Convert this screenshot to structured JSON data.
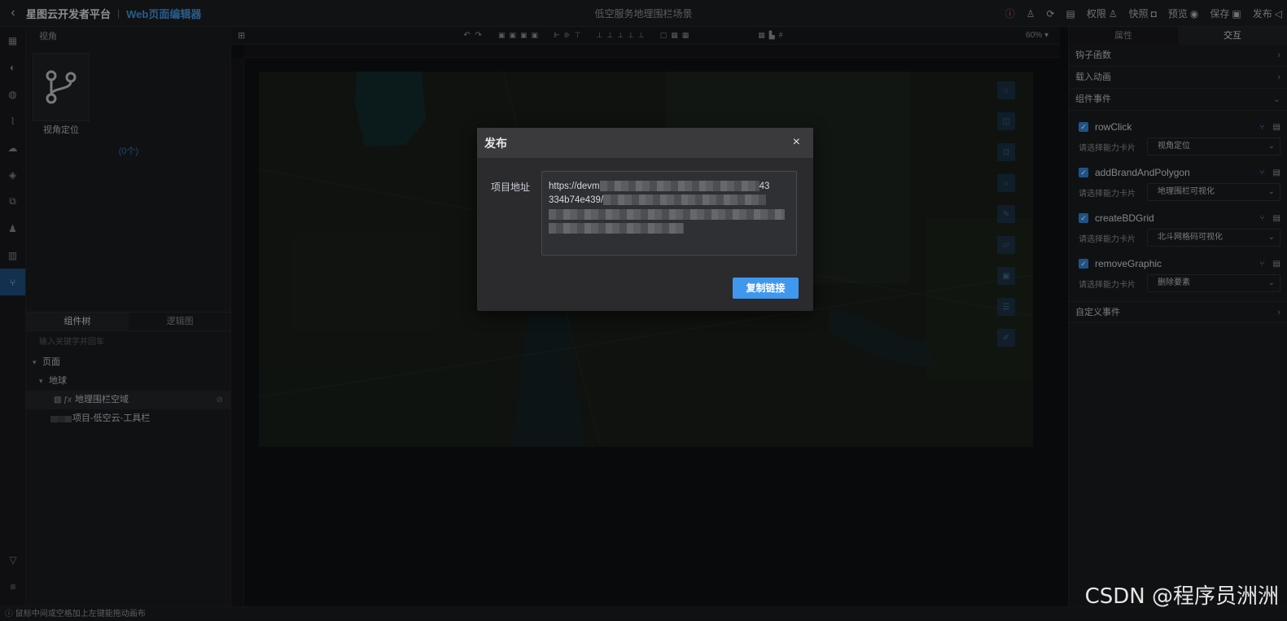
{
  "header": {
    "back_icon": "chevron-left-icon",
    "brand": "星图云开发者平台",
    "separator": "|",
    "editor": "Web页面编辑器",
    "doc_title": "低空服务地理围栏场景",
    "actions": [
      {
        "label": "",
        "icon": "warning-icon"
      },
      {
        "label": "",
        "icon": "shirt-icon"
      },
      {
        "label": "",
        "icon": "refresh-icon"
      },
      {
        "label": "",
        "icon": "save-disk-icon"
      },
      {
        "label": "权限",
        "icon": "user-icon"
      },
      {
        "label": "快照",
        "icon": "camera-icon"
      },
      {
        "label": "预览",
        "icon": "eye-icon"
      },
      {
        "label": "保存",
        "icon": "disk-icon"
      },
      {
        "label": "发布",
        "icon": "send-icon"
      }
    ]
  },
  "left_nav": {
    "items": [
      "grid-icon",
      "palette-icon",
      "globe-icon",
      "chart-icon",
      "cloud-icon",
      "cube-icon",
      "layers-icon",
      "user-pin-icon",
      "table-icon",
      "branch-icon"
    ],
    "active_index": 9,
    "bottom": [
      "filter-icon",
      "database-icon"
    ]
  },
  "left_panel": {
    "header": "视角",
    "view_card_label": "视角定位",
    "count": "(0个)",
    "tabs": [
      "组件树",
      "逻辑图"
    ],
    "active_tab": 0,
    "search_placeholder": "输入关键字并回车",
    "tree": [
      {
        "label": "页面",
        "level": 0,
        "arrow": "▾"
      },
      {
        "label": "地球",
        "level": 1,
        "arrow": "▾"
      },
      {
        "label": "地理围栏空域",
        "level": 2,
        "arrow": "",
        "selected": true
      },
      {
        "label": "项目-低空云-工具栏",
        "level": 2,
        "arrow": ""
      }
    ]
  },
  "canvas": {
    "zoom": "60%"
  },
  "right_panel": {
    "tabs": [
      "属性",
      "交互"
    ],
    "active_tab": 1,
    "sections": {
      "hook": "钩子函数",
      "load_anim": "载入动画",
      "comp_events": "组件事件",
      "custom_events": "自定义事件"
    },
    "events": [
      {
        "name": "rowClick",
        "label": "请选择能力卡片",
        "value": "视角定位"
      },
      {
        "name": "addBrandAndPolygon",
        "label": "请选择能力卡片",
        "value": "地理围栏可视化"
      },
      {
        "name": "createBDGrid",
        "label": "请选择能力卡片",
        "value": "北斗网格码可视化"
      },
      {
        "name": "removeGraphic",
        "label": "请选择能力卡片",
        "value": "删除要素"
      }
    ]
  },
  "status": {
    "hint": "鼠标中间或空格加上左键能拖动画布"
  },
  "modal": {
    "title": "发布",
    "close": "×",
    "field_label": "项目地址",
    "url_visible": [
      "https://devm",
      "334b74e439/",
      "",
      ""
    ],
    "url_tail": [
      "43",
      "",
      "",
      ""
    ],
    "copy_button": "复制链接"
  },
  "watermark": "CSDN @程序员洲洲"
}
